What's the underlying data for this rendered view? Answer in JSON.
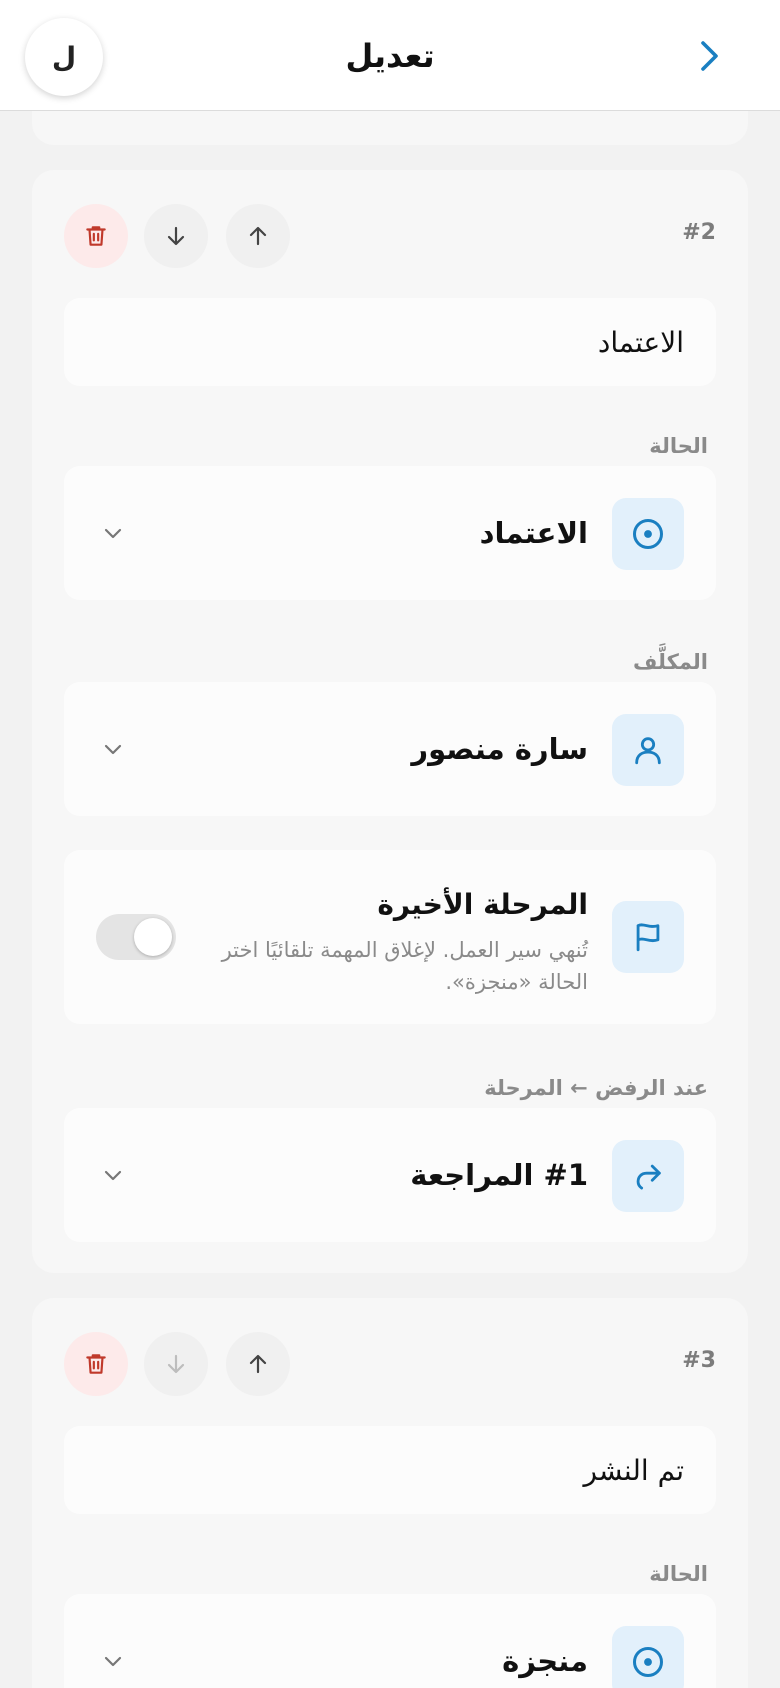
{
  "header": {
    "title": "تعديل",
    "avatar_initial": "ل"
  },
  "steps": [
    {
      "number": "#2",
      "name": "الاعتماد",
      "status_label": "الحالة",
      "status_value": "الاعتماد",
      "assignee_label": "المكلَّف",
      "assignee_value": "سارة منصور",
      "final_stage": {
        "title": "المرحلة الأخيرة",
        "description": "تُنهي سير العمل. لإغلاق المهمة تلقائيًا اختر الحالة «منجزة».",
        "enabled": false
      },
      "on_reject_label": "عند الرفض ← المرحلة",
      "on_reject_value": "#1 المراجعة"
    },
    {
      "number": "#3",
      "name": "تم النشر",
      "status_label": "الحالة",
      "status_value": "منجزة"
    }
  ],
  "icons": {
    "back": "chevron-right-icon",
    "delete": "trash-icon",
    "move_down": "arrow-down-icon",
    "move_up": "arrow-up-icon",
    "status": "target-circle-icon",
    "assignee": "user-icon",
    "final": "flag-icon",
    "reject": "redirect-arrow-icon",
    "dropdown": "chevron-down-icon"
  },
  "colors": {
    "accent": "#1a7fc1",
    "danger": "#c0392b",
    "icon_bg": "#e2f0fb"
  }
}
